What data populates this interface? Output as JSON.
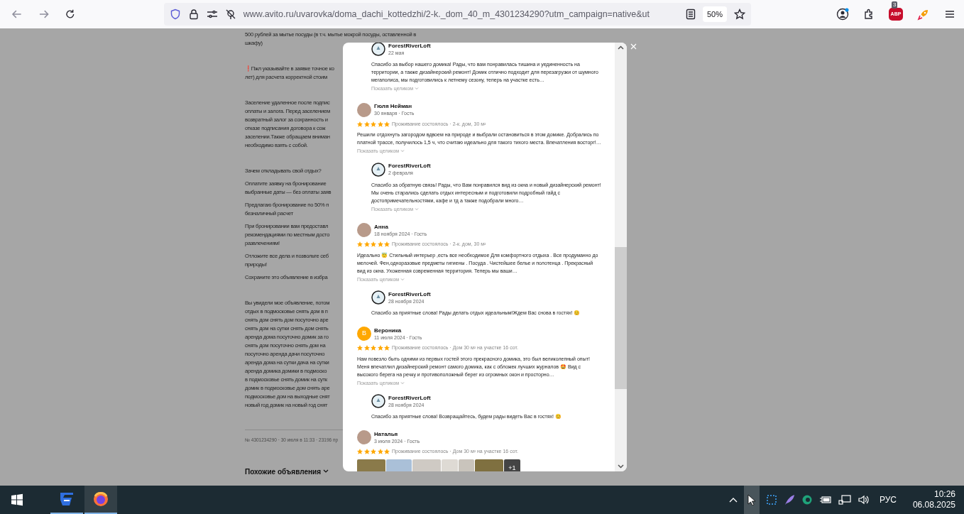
{
  "browser": {
    "url": "www.avito.ru/uvarovka/doma_dachi_kottedzhi/2-k._dom_40_m_4301234290?utm_campaign=native&ut",
    "zoom": "50%",
    "abp_label": "ABP",
    "abp_badge": "3"
  },
  "page": {
    "paragraphs": [
      [
        "500 рублей за мытье посуды (в т.ч. мытье мокрой посуды, оставленной в",
        "шкафу)"
      ],
      [
        "❗Пжл указывайте в заявке точное ко",
        "лет) для расчета корректной стоим"
      ],
      [
        "Заселение удаленное после подпис",
        "оплаты и залога. Перед заселением",
        "возвратный залог за сохранность и",
        "отказе подписания договора к сож",
        "заселении.Также обращаем вниман",
        "необходимо взять с собой."
      ],
      [
        "Зачем откладывать свой отдых?"
      ],
      [
        "Оплатите заявку на бронирование",
        "выбранные даты — без оплаты заяв"
      ],
      [
        "Предлагаю бронирование по 50% п",
        "безналичный расчет"
      ],
      [
        "При бронировании вам предоставл",
        "рекомендациями по местным досто",
        "развлечениям!"
      ],
      [
        "Отложите все дела и позвольте себ",
        "природы!"
      ],
      [
        "Сохраните это объявление в избра"
      ],
      [
        "Вы увидели мое объявление, потом",
        "отдых в подмосковье снять дом в п",
        "снять дом снять дом посуточно аре",
        "снять дом на сутки снять дом снять",
        "аренда дома посуточно домик за го",
        "снять дом посуточно снять дом на",
        "посуточно аренда дачи посуточно",
        "аренда дома на сутки дача на сутки",
        "аренда домика домики в подмоско",
        "в подмосковье снять домик на сутк",
        "домик в подмосковье дом снять аре",
        "подмосковье дом на выходные снят",
        "новый год домик на новый год снят"
      ]
    ],
    "listing_meta": "№ 4301234290 · 30 июля в 11:33 · 23196 пр",
    "similar_heading": "Похожие объявления"
  },
  "modal": {
    "reviews": [
      {
        "kind": "reply",
        "author": "ForestRiverLoft",
        "date": "22 мая",
        "text": "Спасибо за выбор нашего домика! Рады, что вам понравилась тишина и уединенность на территории, а также дизайнерский ремонт! Домик отлично подходит для перезагрузки от шумного мегаполиса, мы подготовились к летнему сезону, теперь на участке есть…",
        "expand": "Показать целиком"
      },
      {
        "kind": "review",
        "author": "Гюля Нейман",
        "date": "30 января · Гость",
        "stars": 5,
        "stay": "Проживание состоялось · 2-к. дом, 30 м²",
        "text": "Решили отдохнуть загородом вдвоем на природе и выбрали остановиться в этом домике. Добрались по платной трассе, получилось 1,5 ч, что считаю идеально для такого тихого места. Впечатления восторг!…",
        "expand": "Показать целиком"
      },
      {
        "kind": "reply",
        "author": "ForestRiverLoft",
        "date": "2 февраля",
        "text": "Спасибо за обратную связь! Рады, что Вам понравился вид из окна и новый дизайнерский ремонт! Мы очень старались сделать отдых интересным и подготовили подробный гайд с достопримечательностями, кафе и тд а также подобрали много…",
        "expand": "Показать целиком"
      },
      {
        "kind": "review",
        "author": "Анна",
        "date": "18 ноября 2024 · Гость",
        "stars": 5,
        "stay": "Проживание состоялось · 2-к. дом, 30 м²",
        "text": "Идеально 😇 Стильный интерьер ,есть все необходимое Для комфортного отдыха . Все продуманно до мелочей. Фен,одноразовые предметы гигиены . Посуда . Чистейшее белье и полотенца . Прекрасный вид из окна. Ухоженная современная территория. Теперь мы ваши…",
        "expand": "Показать целиком"
      },
      {
        "kind": "reply",
        "author": "ForestRiverLoft",
        "date": "28 ноября 2024",
        "text": "Спасибо за приятные слова! Рады делать отдых идеальным!Ждем Вас снова в гостях! 😊"
      },
      {
        "kind": "review",
        "author": "Вероника",
        "avatar_letter": "В",
        "date": "11 июля 2024 · Гость",
        "stars": 5,
        "stay": "Проживание состоялось · Дом 30 м² на участке 16 сот.",
        "text": "Нам повезло быть одними из первых гостей этого прекрасного домика, это был великолепный опыт! Меня впечатлил дизайнерский ремонт самого домика, как с обложек лучших журналов 🤩 Вид с высокого берега на речку и противоположный берег из огромных окон и просторно…",
        "expand": "Показать целиком"
      },
      {
        "kind": "reply",
        "author": "ForestRiverLoft",
        "date": "28 ноября 2024",
        "text": "Спасибо за приятные слова! Возвращайтесь, будем рады видеть Вас в гостях! 😊"
      },
      {
        "kind": "review",
        "author": "Наталья",
        "date": "3 июля 2024 · Гость",
        "stars": 5,
        "stay": "Проживание состоялось · Дом 30 м² на участке 16 сот.",
        "photos_more": "+1"
      }
    ]
  },
  "taskbar": {
    "language": "РУС",
    "time": "10:26",
    "date": "06.08.2025"
  }
}
